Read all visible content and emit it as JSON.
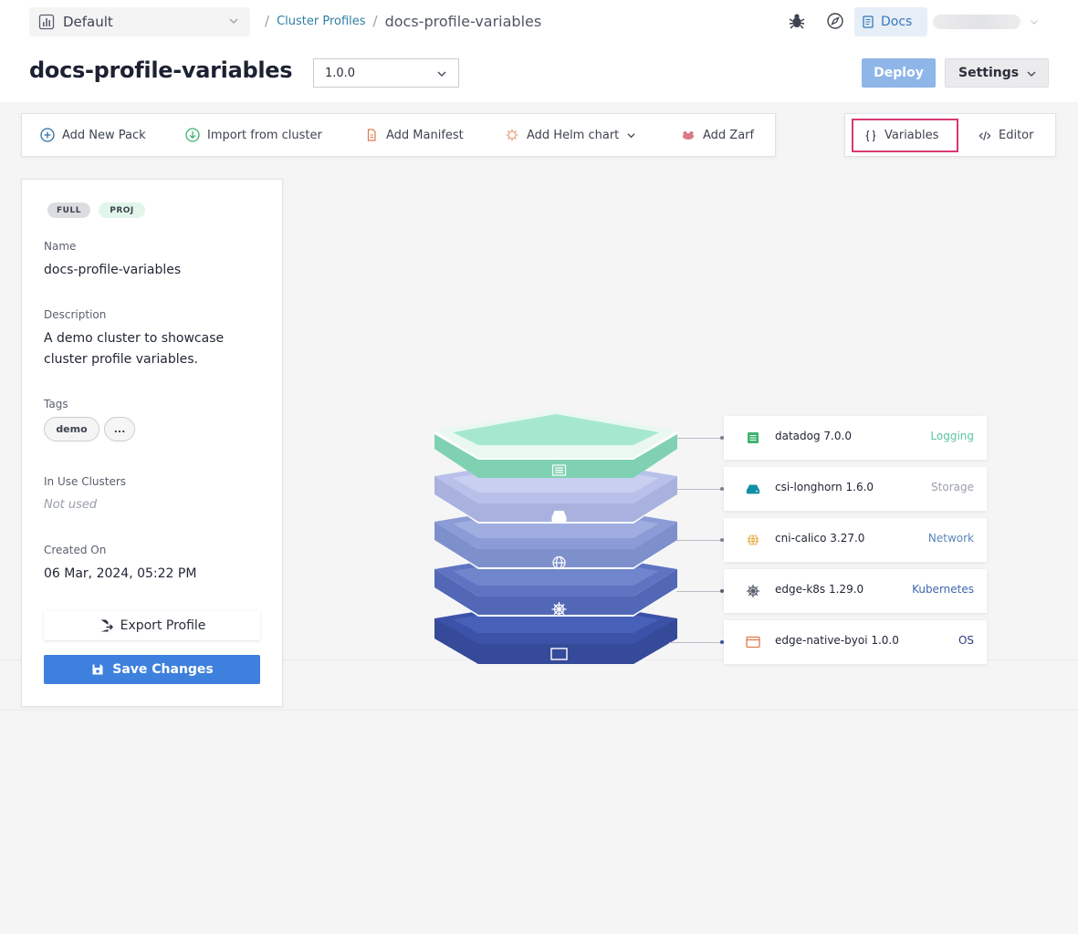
{
  "header": {
    "project": "Default",
    "breadcrumb_link": "Cluster Profiles",
    "breadcrumb_sep": "/",
    "breadcrumb_current": "docs-profile-variables",
    "docs_label": "Docs"
  },
  "profile": {
    "title": "docs-profile-variables",
    "version": "1.0.0",
    "deploy_label": "Deploy",
    "settings_label": "Settings"
  },
  "toolbar": {
    "add_pack": "Add New Pack",
    "import_cluster": "Import from cluster",
    "add_manifest": "Add Manifest",
    "add_helm": "Add Helm chart",
    "add_zarf": "Add Zarf",
    "variables": "Variables",
    "editor": "Editor"
  },
  "info": {
    "badge_full": "FULL",
    "badge_proj": "PROJ",
    "name_label": "Name",
    "name_value": "docs-profile-variables",
    "description_label": "Description",
    "description_value": "A demo cluster to showcase cluster profile variables.",
    "tags_label": "Tags",
    "tags": [
      "demo",
      "..."
    ],
    "in_use_label": "In Use Clusters",
    "in_use_value": "Not used",
    "created_label": "Created On",
    "created_value": "06 Mar, 2024, 05:22 PM",
    "export_label": "Export Profile",
    "save_label": "Save Changes"
  },
  "packs": [
    {
      "name": "datadog 7.0.0",
      "layer": "Logging",
      "icon": "logging-list-icon",
      "layer_color": "#5cc3a3",
      "icon_color": "#3db46d"
    },
    {
      "name": "csi-longhorn 1.6.0",
      "layer": "Storage",
      "icon": "storage-drive-icon",
      "layer_color": "#9aa0aa",
      "icon_color": "#0f8fa8"
    },
    {
      "name": "cni-calico 3.27.0",
      "layer": "Network",
      "icon": "network-globe-icon",
      "layer_color": "#5a88b8",
      "icon_color": "#e5a93a"
    },
    {
      "name": "edge-k8s 1.29.0",
      "layer": "Kubernetes",
      "icon": "kubernetes-helm-icon",
      "layer_color": "#3e66b0",
      "icon_color": "#5a606e"
    },
    {
      "name": "edge-native-byoi 1.0.0",
      "layer": "OS",
      "icon": "os-window-icon",
      "layer_color": "#2b3a80",
      "icon_color": "#e07a4a"
    }
  ],
  "colors": {
    "accent": "#3e80dd",
    "highlight_border": "#d63a74",
    "layer_logging": "#a6e8cf",
    "layer_storage": "#c4cbef",
    "layer_network": "#97a6dc",
    "layer_kubernetes": "#6a80c8",
    "layer_os": "#3c52a8"
  }
}
